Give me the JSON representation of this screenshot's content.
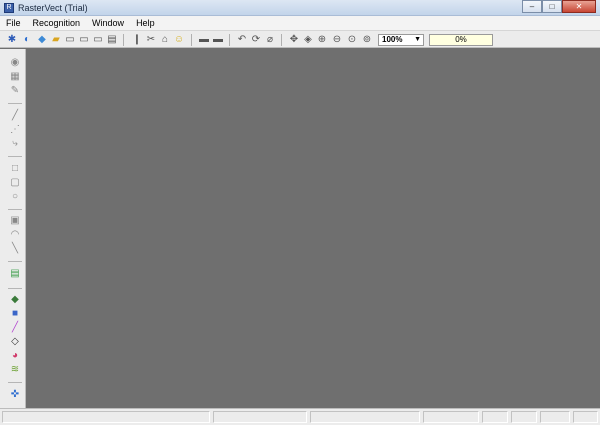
{
  "window": {
    "title": "RasterVect (Trial)",
    "min": "–",
    "max": "□",
    "close": "✕"
  },
  "menu": [
    "File",
    "Recognition",
    "Window",
    "Help"
  ],
  "toolbar": {
    "zoom": "100%",
    "progress": "0%"
  }
}
